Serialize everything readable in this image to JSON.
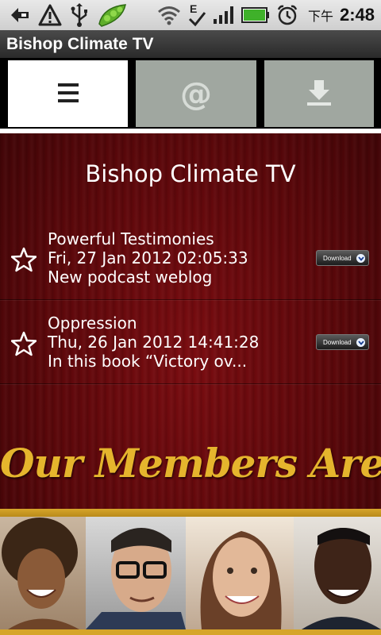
{
  "status_bar": {
    "ampm": "下午",
    "time": "2:48",
    "network_label": "E",
    "icons": [
      "back-arrow-icon",
      "warning-icon",
      "usb-icon",
      "pea-pod-icon",
      "wifi-icon",
      "network-e-icon",
      "signal-icon",
      "battery-icon",
      "alarm-icon"
    ]
  },
  "app": {
    "title": "Bishop Climate TV"
  },
  "tabs": [
    {
      "name": "list",
      "icon": "list-icon",
      "glyph": "☰",
      "selected": true
    },
    {
      "name": "at",
      "icon": "at-icon",
      "glyph": "@",
      "selected": false
    },
    {
      "name": "download",
      "icon": "download-icon",
      "selected": false
    }
  ],
  "main": {
    "title": "Bishop Climate TV",
    "items": [
      {
        "title": "Powerful Testimonies",
        "date": "Fri, 27 Jan 2012 02:05:33",
        "summary": "New podcast weblog",
        "download_label": "Download"
      },
      {
        "title": "Oppression",
        "date": "Thu, 26 Jan 2012 14:41:28",
        "summary": "In this book “Victory ov...",
        "download_label": "Download"
      }
    ]
  },
  "banner": {
    "text": "Our Members  Are Great"
  },
  "colors": {
    "background_red": "#5a070a",
    "gold": "#e5b52d",
    "tab_inactive": "#a0a7a0"
  }
}
